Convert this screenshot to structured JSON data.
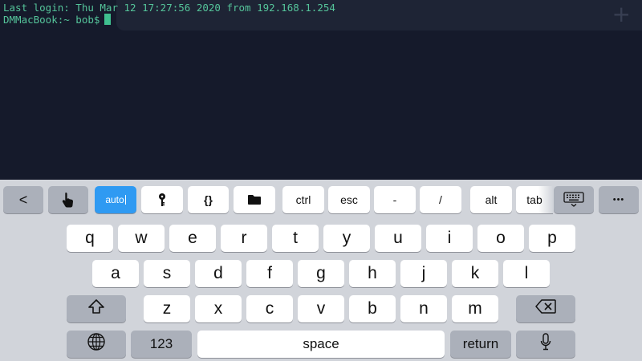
{
  "terminal": {
    "last_login": "Last login: Thu Mar 12 17:27:56 2020 from 192.168.1.254",
    "prompt": "DMMacBook:~ bob$",
    "add_tab_glyph": "+"
  },
  "toolbar": {
    "back_glyph": "<",
    "auto_label": "auto",
    "braces_label": "{}",
    "ctrl_label": "ctrl",
    "esc_label": "esc",
    "dash_label": "-",
    "slash_label": "/",
    "alt_label": "alt",
    "tab_label": "tab",
    "more_label": "•••"
  },
  "keyboard": {
    "row1": [
      "q",
      "w",
      "e",
      "r",
      "t",
      "y",
      "u",
      "i",
      "o",
      "p"
    ],
    "row2": [
      "a",
      "s",
      "d",
      "f",
      "g",
      "h",
      "j",
      "k",
      "l"
    ],
    "row3": [
      "z",
      "x",
      "c",
      "v",
      "b",
      "n",
      "m"
    ],
    "numbers_label": "123",
    "space_label": "space",
    "return_label": "return"
  },
  "colors": {
    "terminal_bg": "#151a2b",
    "terminal_text": "#55c49a",
    "keyboard_bg": "#d1d4da",
    "active_key": "#2f9af2"
  }
}
